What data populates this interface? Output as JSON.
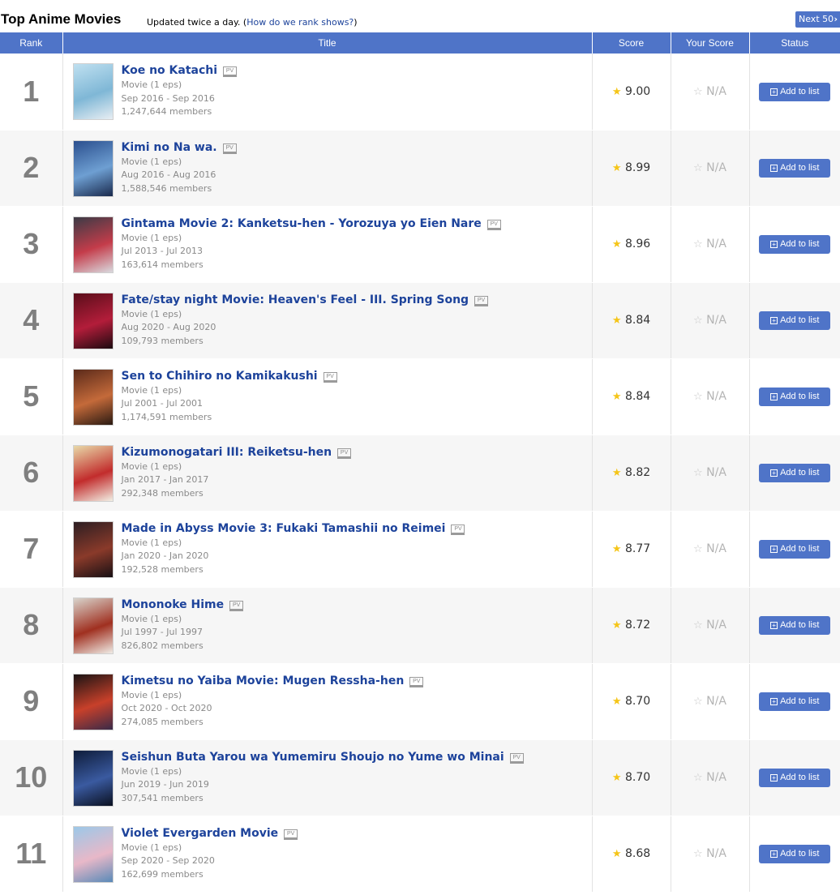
{
  "header": {
    "title": "Top Anime Movies",
    "updated_text": "Updated twice a day.",
    "paren_open": "(",
    "rank_link": "How do we rank shows?",
    "paren_close": ")",
    "next_label": "Next 50",
    "next_icon": "chevron-right-icon"
  },
  "columns": {
    "rank": "Rank",
    "title": "Title",
    "score": "Score",
    "your_score": "Your Score",
    "status": "Status"
  },
  "colors": {
    "header_bg": "#4f74c8",
    "title_link": "#1d439b",
    "star": "#f5c518"
  },
  "rows": [
    {
      "rank": "1",
      "title": "Koe no Katachi",
      "pv": "PV",
      "type": "Movie (1 eps)",
      "dates": "Sep 2016 - Sep 2016",
      "members": "1,247,644 members",
      "score": "9.00",
      "your_score": "N/A",
      "status": "Add to list",
      "thumb": [
        "#bfe0f0",
        "#7fb7d6",
        "#e8eef3"
      ]
    },
    {
      "rank": "2",
      "title": "Kimi no Na wa.",
      "pv": "PV",
      "type": "Movie (1 eps)",
      "dates": "Aug 2016 - Aug 2016",
      "members": "1,588,546 members",
      "score": "8.99",
      "your_score": "N/A",
      "status": "Add to list",
      "thumb": [
        "#2b4f8e",
        "#6e9fd2",
        "#1a2a4d"
      ]
    },
    {
      "rank": "3",
      "title": "Gintama Movie 2: Kanketsu-hen - Yorozuya yo Eien Nare",
      "pv": "PV",
      "type": "Movie (1 eps)",
      "dates": "Jul 2013 - Jul 2013",
      "members": "163,614 members",
      "score": "8.96",
      "your_score": "N/A",
      "status": "Add to list",
      "thumb": [
        "#3b3b46",
        "#c43c4a",
        "#d9d9de"
      ]
    },
    {
      "rank": "4",
      "title": "Fate/stay night Movie: Heaven's Feel - III. Spring Song",
      "pv": "PV",
      "type": "Movie (1 eps)",
      "dates": "Aug 2020 - Aug 2020",
      "members": "109,793 members",
      "score": "8.84",
      "your_score": "N/A",
      "status": "Add to list",
      "thumb": [
        "#5a0e1a",
        "#b31d3a",
        "#1c0a10"
      ]
    },
    {
      "rank": "5",
      "title": "Sen to Chihiro no Kamikakushi",
      "pv": "PV",
      "type": "Movie (1 eps)",
      "dates": "Jul 2001 - Jul 2001",
      "members": "1,174,591 members",
      "score": "8.84",
      "your_score": "N/A",
      "status": "Add to list",
      "thumb": [
        "#5b2a1a",
        "#c46a3a",
        "#2a1a12"
      ]
    },
    {
      "rank": "6",
      "title": "Kizumonogatari III: Reiketsu-hen",
      "pv": "PV",
      "type": "Movie (1 eps)",
      "dates": "Jan 2017 - Jan 2017",
      "members": "292,348 members",
      "score": "8.82",
      "your_score": "N/A",
      "status": "Add to list",
      "thumb": [
        "#e8d9a8",
        "#c22c2c",
        "#f2efe4"
      ]
    },
    {
      "rank": "7",
      "title": "Made in Abyss Movie 3: Fukaki Tamashii no Reimei",
      "pv": "PV",
      "type": "Movie (1 eps)",
      "dates": "Jan 2020 - Jan 2020",
      "members": "192,528 members",
      "score": "8.77",
      "your_score": "N/A",
      "status": "Add to list",
      "thumb": [
        "#2c1e22",
        "#8a3a2a",
        "#181014"
      ]
    },
    {
      "rank": "8",
      "title": "Mononoke Hime",
      "pv": "PV",
      "type": "Movie (1 eps)",
      "dates": "Jul 1997 - Jul 1997",
      "members": "826,802 members",
      "score": "8.72",
      "your_score": "N/A",
      "status": "Add to list",
      "thumb": [
        "#d8d4cc",
        "#a03020",
        "#f0ece6"
      ]
    },
    {
      "rank": "9",
      "title": "Kimetsu no Yaiba Movie: Mugen Ressha-hen",
      "pv": "PV",
      "type": "Movie (1 eps)",
      "dates": "Oct 2020 - Oct 2020",
      "members": "274,085 members",
      "score": "8.70",
      "your_score": "N/A",
      "status": "Add to list",
      "thumb": [
        "#1a1414",
        "#c8402a",
        "#3a2a48"
      ]
    },
    {
      "rank": "10",
      "title": "Seishun Buta Yarou wa Yumemiru Shoujo no Yume wo Minai",
      "pv": "PV",
      "type": "Movie (1 eps)",
      "dates": "Jun 2019 - Jun 2019",
      "members": "307,541 members",
      "score": "8.70",
      "your_score": "N/A",
      "status": "Add to list",
      "thumb": [
        "#0e1c3a",
        "#3a5aa0",
        "#0a1020"
      ]
    },
    {
      "rank": "11",
      "title": "Violet Evergarden Movie",
      "pv": "PV",
      "type": "Movie (1 eps)",
      "dates": "Sep 2020 - Sep 2020",
      "members": "162,699 members",
      "score": "8.68",
      "your_score": "N/A",
      "status": "Add to list",
      "thumb": [
        "#9cc8e8",
        "#e8b8c8",
        "#5a8ab8"
      ]
    }
  ]
}
